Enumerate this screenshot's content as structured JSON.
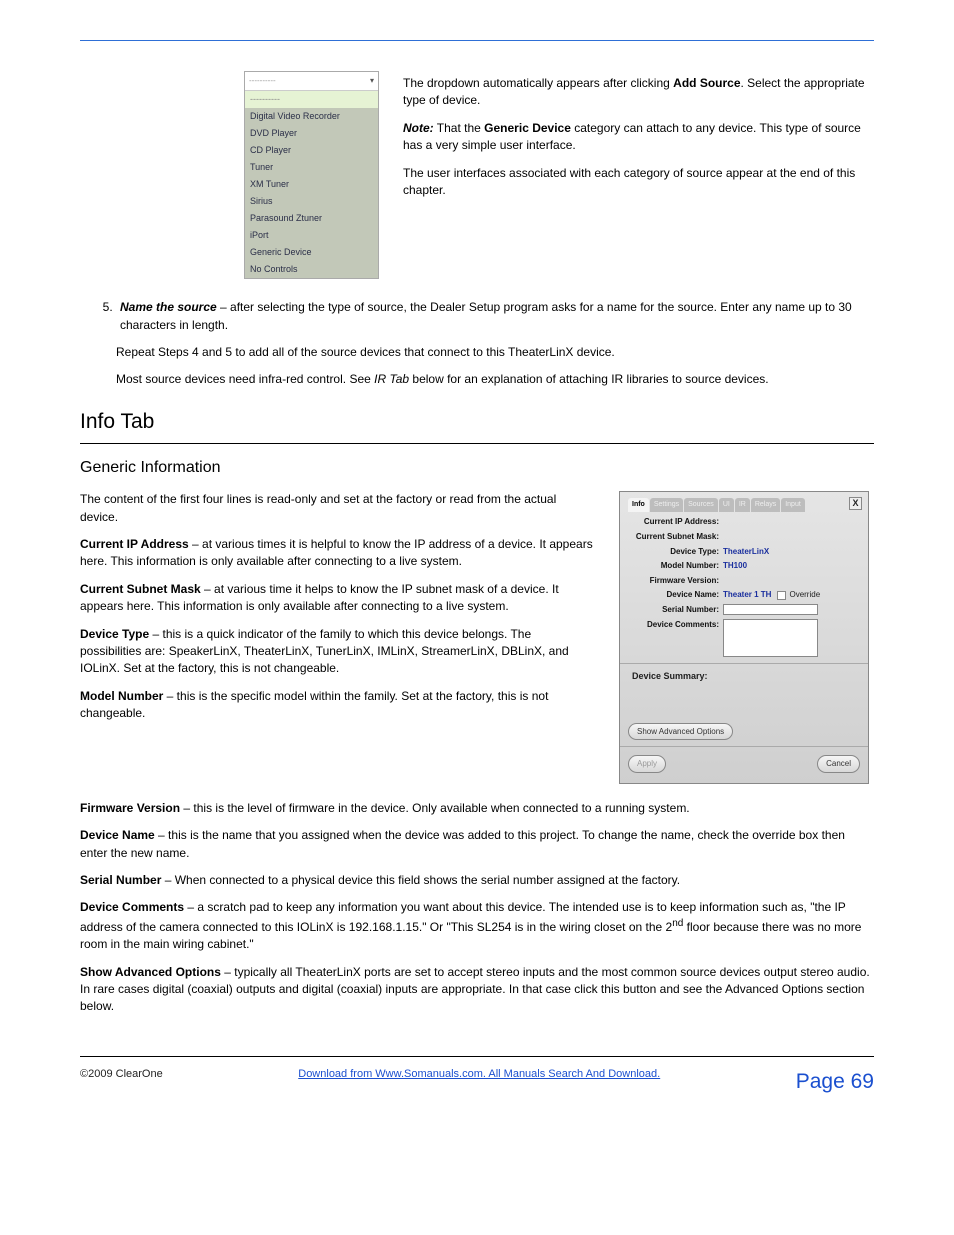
{
  "header_rule": true,
  "dropdown": {
    "placeholder": "----------",
    "arrow": "▾",
    "items": [
      "----------",
      "Digital Video Recorder",
      "DVD Player",
      "CD Player",
      "Tuner",
      "XM Tuner",
      "Sirius",
      "Parasound Ztuner",
      "iPort",
      "Generic Device",
      "No Controls"
    ]
  },
  "intro_para": "The dropdown automatically appears after clicking",
  "intro_bold": "Add Source",
  "intro_tail": ". Select the appropriate type of device.",
  "note": {
    "label": "Note:",
    "body_1": "That the ",
    "body_bold": "Generic Device",
    "body_2": " category can attach to any device. This type of source has a very simple user interface."
  },
  "ui_note": "The user interfaces associated with each category of source appear at the end of this chapter.",
  "step5": {
    "num": "5.",
    "lead": "Name the source",
    "body": " – after selecting the type of source, the Dealer Setup program asks for a name for the source. Enter any name up to 30 characters in length."
  },
  "repeat": {
    "p1": "Repeat Steps 4 and 5 to add all of the source devices that connect to this TheaterLinX device.",
    "p2a": "Most source devices need infra-red control. See ",
    "p2link": "IR Tab",
    "p2b": " below for an explanation of attaching IR libraries to source devices."
  },
  "info_tab": {
    "heading": "Info Tab",
    "subhead": "Generic Information",
    "para": "The content of the first four lines is read-only and set at the factory or read from the actual device."
  },
  "dialog": {
    "tabs": [
      "Info",
      "Settings",
      "Sources",
      "UI",
      "IR",
      "Relays",
      "Input"
    ],
    "active_tab": 0,
    "close": "X",
    "rows": {
      "ip_label": "Current IP Address:",
      "subnet_label": "Current Subnet Mask:",
      "devtype_label": "Device Type:",
      "devtype_value": "TheaterLinX",
      "model_label": "Model Number:",
      "model_value": "TH100",
      "fw_label": "Firmware Version:",
      "devname_label": "Device Name:",
      "devname_value": "Theater 1 TH",
      "override_label": "Override",
      "serial_label": "Serial Number:",
      "comments_label": "Device Comments:"
    },
    "summary_label": "Device Summary:",
    "adv_button": "Show Advanced Options",
    "apply": "Apply",
    "cancel": "Cancel"
  },
  "fields": {
    "ip": {
      "label": "Current IP Address",
      "body": " – at various times it is helpful to know the IP address of a device. It appears here. This information is only available after connecting to a live system."
    },
    "subnet": {
      "label": "Current Subnet Mask",
      "body": " – at various time it helps to know the IP subnet mask of a device. It appears here. This information is only available after connecting to a live system."
    },
    "devtype": {
      "label": "Device Type",
      "body": " – this is a quick indicator of the family to which this device belongs. The possibilities are: SpeakerLinX, TheaterLinX, TunerLinX, IMLinX, StreamerLinX, DBLinX, and IOLinX. Set at the factory, this is not changeable."
    },
    "model": {
      "label": "Model Number",
      "body": " – this is the specific model within the family. Set at the factory, this is not changeable."
    },
    "fw": {
      "label": "Firmware Version",
      "body": " – this is the level of firmware in the device. Only available when connected to a running system."
    },
    "name": {
      "label": "Device Name",
      "body": " – this is the name that you assigned when the device was added to this project. To change the name, check the override box then enter the new name."
    },
    "serial": {
      "label": "Serial Number",
      "body": " – When connected to a physical device this field shows the serial number assigned at the factory."
    },
    "comments": {
      "label": "Device Comments",
      "body_1": " – a scratch pad to keep any information you want about this device. The intended use is to keep information such as, \"the IP address of the camera connected to this IOLinX is 192.168.1.15.\" Or \"This SL254 is in the wiring closet on the 2",
      "sup": "nd",
      "body_2": " floor because there was no more room in the main wiring cabinet.\""
    },
    "adv": {
      "label": "Show Advanced Options",
      "body": " – typically all TheaterLinX ports are set to accept stereo inputs and the most common source devices output stereo audio. In rare cases digital (coaxial) outputs and digital (coaxial) inputs are appropriate. In that case click this button and see the Advanced Options section below."
    }
  },
  "footer": {
    "copyright": "©2009 ClearOne",
    "center_prefix": "Download from Www.Somanuals.com. All Manuals Search And Download.",
    "page": "Page 69"
  }
}
